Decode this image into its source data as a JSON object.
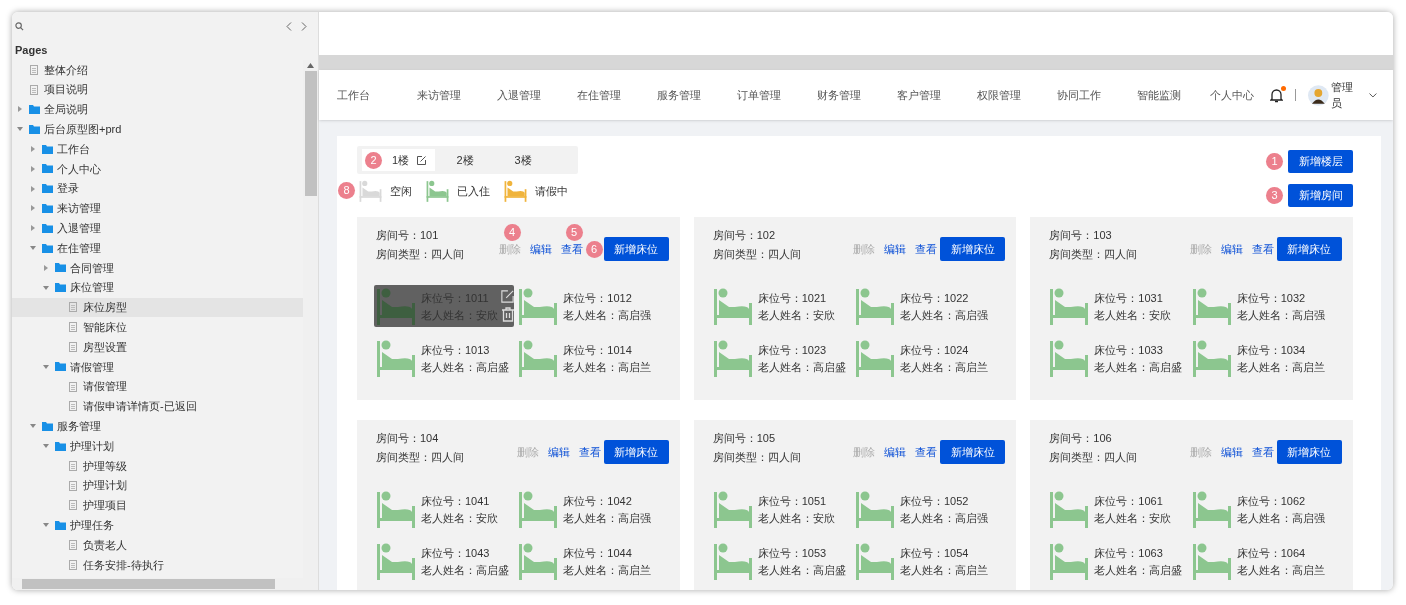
{
  "sidebar": {
    "title": "Pages",
    "tree": [
      {
        "label": "整体介绍",
        "kind": "page",
        "selected": false
      },
      {
        "label": "项目说明",
        "kind": "page",
        "selected": false
      },
      {
        "label": "全局说明",
        "kind": "folder",
        "expanded": false,
        "selected": false
      },
      {
        "label": "后台原型图+prd",
        "kind": "folder",
        "expanded": true,
        "selected": false,
        "children": [
          {
            "label": "工作台",
            "kind": "folder",
            "expanded": false,
            "selected": false
          },
          {
            "label": "个人中心",
            "kind": "folder",
            "expanded": false,
            "selected": false
          },
          {
            "label": "登录",
            "kind": "folder",
            "expanded": false,
            "selected": false
          },
          {
            "label": "来访管理",
            "kind": "folder",
            "expanded": false,
            "selected": false
          },
          {
            "label": "入退管理",
            "kind": "folder",
            "expanded": false,
            "selected": false
          },
          {
            "label": "在住管理",
            "kind": "folder",
            "expanded": true,
            "selected": false,
            "children": [
              {
                "label": "合同管理",
                "kind": "folder",
                "expanded": false,
                "selected": false
              },
              {
                "label": "床位管理",
                "kind": "folder",
                "expanded": true,
                "selected": false,
                "children": [
                  {
                    "label": "床位房型",
                    "kind": "page",
                    "selected": true
                  },
                  {
                    "label": "智能床位",
                    "kind": "page",
                    "selected": false
                  },
                  {
                    "label": "房型设置",
                    "kind": "page",
                    "selected": false
                  }
                ]
              },
              {
                "label": "请假管理",
                "kind": "folder",
                "expanded": true,
                "selected": false,
                "children": [
                  {
                    "label": "请假管理",
                    "kind": "page",
                    "selected": false
                  },
                  {
                    "label": "请假申请详情页-已返回",
                    "kind": "page",
                    "selected": false
                  }
                ]
              }
            ]
          },
          {
            "label": "服务管理",
            "kind": "folder",
            "expanded": true,
            "selected": false,
            "children": [
              {
                "label": "护理计划",
                "kind": "folder",
                "expanded": true,
                "selected": false,
                "children": [
                  {
                    "label": "护理等级",
                    "kind": "page",
                    "selected": false
                  },
                  {
                    "label": "护理计划",
                    "kind": "page",
                    "selected": false
                  },
                  {
                    "label": "护理项目",
                    "kind": "page",
                    "selected": false
                  }
                ]
              },
              {
                "label": "护理任务",
                "kind": "folder",
                "expanded": true,
                "selected": false,
                "children": [
                  {
                    "label": "负责老人",
                    "kind": "page",
                    "selected": false
                  },
                  {
                    "label": "任务安排-待执行",
                    "kind": "page",
                    "selected": false
                  }
                ]
              }
            ]
          }
        ]
      }
    ]
  },
  "nav": {
    "items": [
      "工作台",
      "来访管理",
      "入退管理",
      "在住管理",
      "服务管理",
      "订单管理",
      "财务管理",
      "客户管理",
      "权限管理",
      "协同工作",
      "智能监测",
      "个人中心"
    ],
    "notification_dot": true,
    "user": "管理员"
  },
  "floors": {
    "marker": "2",
    "tabs": [
      {
        "label": "1楼",
        "selected": true
      },
      {
        "label": "2楼",
        "selected": false
      },
      {
        "label": "3楼",
        "selected": false
      }
    ]
  },
  "legend": {
    "marker": "8",
    "items": [
      {
        "label": "空闲",
        "color": "#d9d9d9"
      },
      {
        "label": "已入住",
        "color": "#8cc68f"
      },
      {
        "label": "请假中",
        "color": "#f0b43c"
      }
    ]
  },
  "actions": [
    {
      "label": "新增楼层",
      "marker": "1"
    },
    {
      "label": "新增房间",
      "marker": "3"
    }
  ],
  "rooms": [
    {
      "number": "房间号：101",
      "type": "房间类型：四人间",
      "delete": "删除",
      "delete_marker": "4",
      "edit": "编辑",
      "view": "查看",
      "view_marker": "5",
      "add": "新增床位",
      "add_marker": "6",
      "beds": [
        {
          "number": "床位号：1011",
          "elder": "老人姓名：安欣",
          "color": "#3e5f40",
          "hovered": true
        },
        {
          "number": "床位号：1012",
          "elder": "老人姓名：高启强",
          "color": "#8cc68f",
          "hovered": false
        },
        {
          "number": "床位号：1013",
          "elder": "老人姓名：高启盛",
          "color": "#8cc68f",
          "hovered": false
        },
        {
          "number": "床位号：1014",
          "elder": "老人姓名：高启兰",
          "color": "#8cc68f",
          "hovered": false
        }
      ]
    },
    {
      "number": "房间号：102",
      "type": "房间类型：四人间",
      "delete": "删除",
      "edit": "编辑",
      "view": "查看",
      "add": "新增床位",
      "beds": [
        {
          "number": "床位号：1021",
          "elder": "老人姓名：安欣",
          "color": "#8cc68f",
          "hovered": false
        },
        {
          "number": "床位号：1022",
          "elder": "老人姓名：高启强",
          "color": "#8cc68f",
          "hovered": false
        },
        {
          "number": "床位号：1023",
          "elder": "老人姓名：高启盛",
          "color": "#8cc68f",
          "hovered": false
        },
        {
          "number": "床位号：1024",
          "elder": "老人姓名：高启兰",
          "color": "#8cc68f",
          "hovered": false
        }
      ]
    },
    {
      "number": "房间号：103",
      "type": "房间类型：四人间",
      "delete": "删除",
      "edit": "编辑",
      "view": "查看",
      "add": "新增床位",
      "beds": [
        {
          "number": "床位号：1031",
          "elder": "老人姓名：安欣",
          "color": "#8cc68f",
          "hovered": false
        },
        {
          "number": "床位号：1032",
          "elder": "老人姓名：高启强",
          "color": "#8cc68f",
          "hovered": false
        },
        {
          "number": "床位号：1033",
          "elder": "老人姓名：高启盛",
          "color": "#8cc68f",
          "hovered": false
        },
        {
          "number": "床位号：1034",
          "elder": "老人姓名：高启兰",
          "color": "#8cc68f",
          "hovered": false
        }
      ]
    },
    {
      "number": "房间号：104",
      "type": "房间类型：四人间",
      "delete": "删除",
      "edit": "编辑",
      "view": "查看",
      "add": "新增床位",
      "beds": [
        {
          "number": "床位号：1041",
          "elder": "老人姓名：安欣",
          "color": "#8cc68f",
          "hovered": false
        },
        {
          "number": "床位号：1042",
          "elder": "老人姓名：高启强",
          "color": "#8cc68f",
          "hovered": false
        },
        {
          "number": "床位号：1043",
          "elder": "老人姓名：高启盛",
          "color": "#8cc68f",
          "hovered": false
        },
        {
          "number": "床位号：1044",
          "elder": "老人姓名：高启兰",
          "color": "#8cc68f",
          "hovered": false
        }
      ]
    },
    {
      "number": "房间号：105",
      "type": "房间类型：四人间",
      "delete": "删除",
      "edit": "编辑",
      "view": "查看",
      "add": "新增床位",
      "beds": [
        {
          "number": "床位号：1051",
          "elder": "老人姓名：安欣",
          "color": "#8cc68f",
          "hovered": false
        },
        {
          "number": "床位号：1052",
          "elder": "老人姓名：高启强",
          "color": "#8cc68f",
          "hovered": false
        },
        {
          "number": "床位号：1053",
          "elder": "老人姓名：高启盛",
          "color": "#8cc68f",
          "hovered": false
        },
        {
          "number": "床位号：1054",
          "elder": "老人姓名：高启兰",
          "color": "#8cc68f",
          "hovered": false
        }
      ]
    },
    {
      "number": "房间号：106",
      "type": "房间类型：四人间",
      "delete": "删除",
      "edit": "编辑",
      "view": "查看",
      "add": "新增床位",
      "beds": [
        {
          "number": "床位号：1061",
          "elder": "老人姓名：安欣",
          "color": "#8cc68f",
          "hovered": false
        },
        {
          "number": "床位号：1062",
          "elder": "老人姓名：高启强",
          "color": "#8cc68f",
          "hovered": false
        },
        {
          "number": "床位号：1063",
          "elder": "老人姓名：高启盛",
          "color": "#8cc68f",
          "hovered": false
        },
        {
          "number": "床位号：1064",
          "elder": "老人姓名：高启兰",
          "color": "#8cc68f",
          "hovered": false
        }
      ]
    }
  ]
}
